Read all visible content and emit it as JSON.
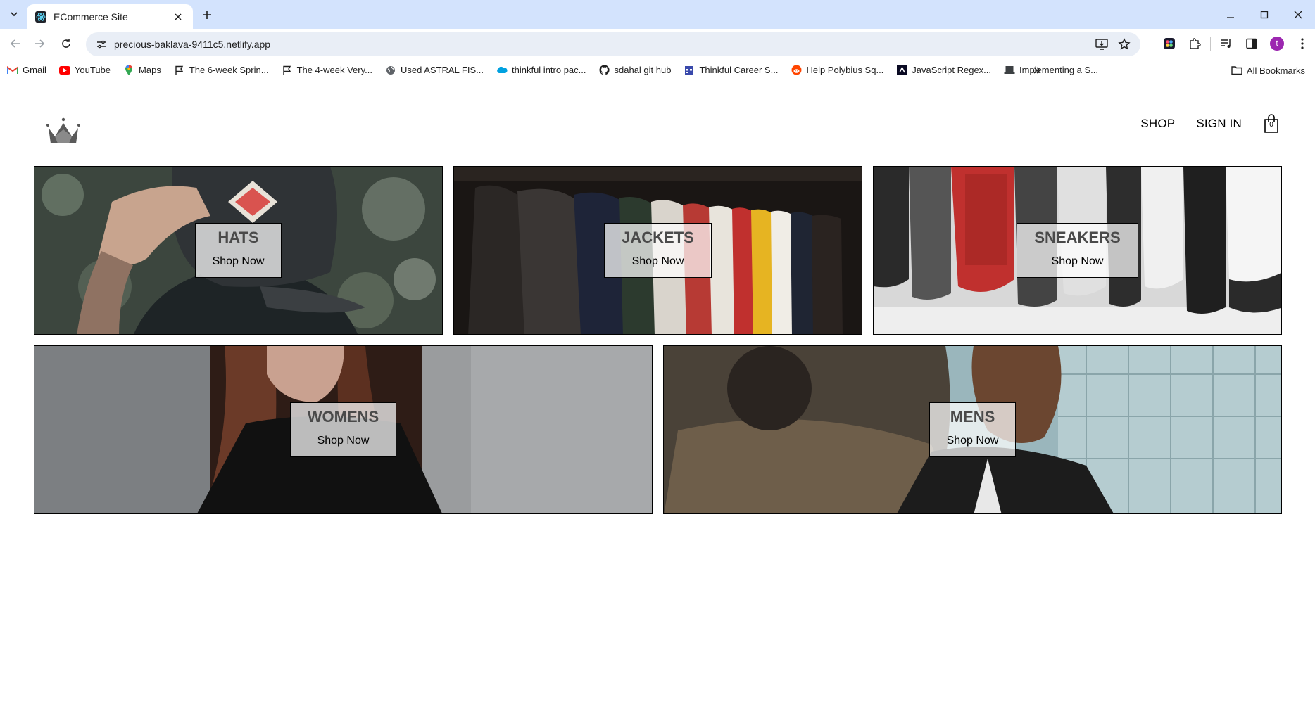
{
  "browser": {
    "tab_title": "ECommerce Site",
    "url": "precious-baklava-9411c5.netlify.app",
    "avatar_letter": "t",
    "bookmarks": [
      {
        "label": "Gmail",
        "icon": "gmail-icon"
      },
      {
        "label": "YouTube",
        "icon": "youtube-icon"
      },
      {
        "label": "Maps",
        "icon": "maps-icon"
      },
      {
        "label": "The 6-week Sprin...",
        "icon": "flag-icon"
      },
      {
        "label": "The 4-week Very...",
        "icon": "flag-icon"
      },
      {
        "label": "Used ASTRAL FIS...",
        "icon": "globe-icon"
      },
      {
        "label": "thinkful intro pac...",
        "icon": "salesforce-icon"
      },
      {
        "label": "sdahal git hub",
        "icon": "github-icon"
      },
      {
        "label": "Thinkful Career S...",
        "icon": "calendar-icon"
      },
      {
        "label": "Help Polybius Sq...",
        "icon": "reddit-icon"
      },
      {
        "label": "JavaScript Regex...",
        "icon": "freecodecamp-icon"
      },
      {
        "label": "Implementing a S...",
        "icon": "laptop-icon"
      }
    ],
    "all_bookmarks": "All Bookmarks"
  },
  "site": {
    "nav": {
      "shop": "SHOP",
      "sign_in": "SIGN IN",
      "cart_count": "0"
    },
    "categories": [
      {
        "title": "HATS",
        "cta": "Shop Now"
      },
      {
        "title": "JACKETS",
        "cta": "Shop Now"
      },
      {
        "title": "SNEAKERS",
        "cta": "Shop Now"
      },
      {
        "title": "WOMENS",
        "cta": "Shop Now"
      },
      {
        "title": "MENS",
        "cta": "Shop Now"
      }
    ]
  },
  "colors": {
    "tabbar": "#d3e3fd",
    "omnibox": "#e9eef6",
    "border": "#000000"
  }
}
